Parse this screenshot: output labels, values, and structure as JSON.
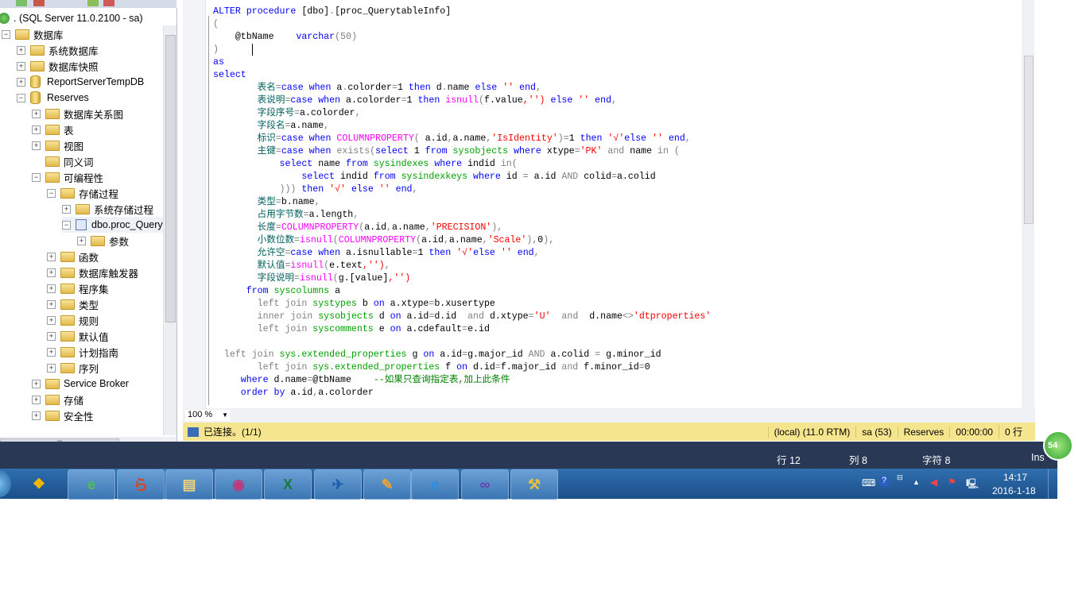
{
  "explorer": {
    "items": [
      {
        "label": ". (SQL Server 11.0.2100 - sa)",
        "icon": "server-icon",
        "level": 0,
        "exp": ""
      },
      {
        "label": "数据库",
        "icon": "folder-icon",
        "level": 0,
        "exp": "-"
      },
      {
        "label": "系统数据库",
        "icon": "folder-icon",
        "level": 1,
        "exp": "+"
      },
      {
        "label": "数据库快照",
        "icon": "folder-icon",
        "level": 1,
        "exp": "+"
      },
      {
        "label": "ReportServerTempDB",
        "icon": "database-icon",
        "level": 1,
        "exp": "+"
      },
      {
        "label": "Reserves",
        "icon": "database-icon",
        "level": 1,
        "exp": "-"
      },
      {
        "label": "数据库关系图",
        "icon": "folder-icon",
        "level": 2,
        "exp": "+"
      },
      {
        "label": "表",
        "icon": "folder-icon",
        "level": 2,
        "exp": "+"
      },
      {
        "label": "视图",
        "icon": "folder-icon",
        "level": 2,
        "exp": "+"
      },
      {
        "label": "同义词",
        "icon": "folder-icon",
        "level": 2,
        "exp": ""
      },
      {
        "label": "可编程性",
        "icon": "folder-icon",
        "level": 2,
        "exp": "-"
      },
      {
        "label": "存储过程",
        "icon": "folder-icon",
        "level": 3,
        "exp": "-"
      },
      {
        "label": "系统存储过程",
        "icon": "folder-icon",
        "level": 4,
        "exp": "+"
      },
      {
        "label": "dbo.proc_Query",
        "icon": "stored-procedure-icon",
        "level": 4,
        "exp": "-",
        "selected": true
      },
      {
        "label": "参数",
        "icon": "folder-icon",
        "level": 5,
        "exp": "+"
      },
      {
        "label": "函数",
        "icon": "folder-icon",
        "level": 3,
        "exp": "+"
      },
      {
        "label": "数据库触发器",
        "icon": "folder-icon",
        "level": 3,
        "exp": "+"
      },
      {
        "label": "程序集",
        "icon": "folder-icon",
        "level": 3,
        "exp": "+"
      },
      {
        "label": "类型",
        "icon": "folder-icon",
        "level": 3,
        "exp": "+"
      },
      {
        "label": "规则",
        "icon": "folder-icon",
        "level": 3,
        "exp": "+"
      },
      {
        "label": "默认值",
        "icon": "folder-icon",
        "level": 3,
        "exp": "+"
      },
      {
        "label": "计划指南",
        "icon": "folder-icon",
        "level": 3,
        "exp": "+"
      },
      {
        "label": "序列",
        "icon": "folder-icon",
        "level": 3,
        "exp": "+"
      },
      {
        "label": "Service Broker",
        "icon": "folder-icon",
        "level": 2,
        "exp": "+"
      },
      {
        "label": "存储",
        "icon": "folder-icon",
        "level": 2,
        "exp": "+"
      },
      {
        "label": "安全性",
        "icon": "folder-icon",
        "level": 2,
        "exp": "+"
      }
    ]
  },
  "editor": {
    "lines": [
      [
        [
          "ALTER",
          "k"
        ],
        [
          " procedure ",
          "k"
        ],
        [
          "[dbo]",
          "n"
        ],
        [
          ".",
          "g"
        ],
        [
          "[proc_QuerytableInfo]",
          "n"
        ]
      ],
      [
        [
          "(",
          "g"
        ]
      ],
      [
        [
          "    @tbName    ",
          "n"
        ],
        [
          "varchar",
          "k"
        ],
        [
          "(50)",
          "g"
        ]
      ],
      [
        [
          ")",
          "g"
        ]
      ],
      [
        [
          "as",
          "k"
        ]
      ],
      [
        [
          "select",
          "k"
        ]
      ],
      [
        [
          "        表名",
          "z"
        ],
        [
          "=",
          "g"
        ],
        [
          "case when ",
          "k"
        ],
        [
          "a",
          "n"
        ],
        [
          ".",
          "g"
        ],
        [
          "colorder",
          "n"
        ],
        [
          "=",
          "g"
        ],
        [
          "1 ",
          "n"
        ],
        [
          "then ",
          "k"
        ],
        [
          "d",
          "n"
        ],
        [
          ".",
          "g"
        ],
        [
          "name ",
          "n"
        ],
        [
          "else ",
          "k"
        ],
        [
          "'' ",
          "s"
        ],
        [
          "end",
          "k"
        ],
        [
          ",",
          "g"
        ]
      ],
      [
        [
          "        表说明",
          "z"
        ],
        [
          "=",
          "g"
        ],
        [
          "case when ",
          "k"
        ],
        [
          "a.colorder",
          "n"
        ],
        [
          "=",
          "g"
        ],
        [
          "1 ",
          "n"
        ],
        [
          "then ",
          "k"
        ],
        [
          "isnull",
          "f"
        ],
        [
          "(",
          "g"
        ],
        [
          "f.value",
          "n"
        ],
        [
          ",'')",
          "s"
        ],
        [
          " else ",
          "k"
        ],
        [
          "'' ",
          "s"
        ],
        [
          "end",
          "k"
        ],
        [
          ",",
          "g"
        ]
      ],
      [
        [
          "        字段序号",
          "z"
        ],
        [
          "=",
          "g"
        ],
        [
          "a.colorder",
          "n"
        ],
        [
          ",",
          "g"
        ]
      ],
      [
        [
          "        字段名",
          "z"
        ],
        [
          "=",
          "g"
        ],
        [
          "a.name",
          "n"
        ],
        [
          ",",
          "g"
        ]
      ],
      [
        [
          "        标识",
          "z"
        ],
        [
          "=",
          "g"
        ],
        [
          "case when ",
          "k"
        ],
        [
          "COLUMNPROPERTY",
          "f"
        ],
        [
          "( ",
          "g"
        ],
        [
          "a.id",
          "n"
        ],
        [
          ",",
          "g"
        ],
        [
          "a.name",
          "n"
        ],
        [
          ",",
          "g"
        ],
        [
          "'IsIdentity'",
          "s"
        ],
        [
          ")=",
          "g"
        ],
        [
          "1 ",
          "n"
        ],
        [
          "then ",
          "k"
        ],
        [
          "'√'",
          "s"
        ],
        [
          "else ",
          "k"
        ],
        [
          "'' ",
          "s"
        ],
        [
          "end",
          "k"
        ],
        [
          ",",
          "g"
        ]
      ],
      [
        [
          "        主键",
          "z"
        ],
        [
          "=",
          "g"
        ],
        [
          "case when ",
          "k"
        ],
        [
          "exists",
          "g"
        ],
        [
          "(",
          "g"
        ],
        [
          "select ",
          "k"
        ],
        [
          "1 ",
          "n"
        ],
        [
          "from ",
          "k"
        ],
        [
          "sysobjects ",
          "t"
        ],
        [
          "where ",
          "k"
        ],
        [
          "xtype",
          "n"
        ],
        [
          "=",
          "g"
        ],
        [
          "'PK' ",
          "s"
        ],
        [
          "and ",
          "g"
        ],
        [
          "name ",
          "n"
        ],
        [
          "in ",
          "g"
        ],
        [
          "(",
          "g"
        ]
      ],
      [
        [
          "            select ",
          "k"
        ],
        [
          "name ",
          "n"
        ],
        [
          "from ",
          "k"
        ],
        [
          "sysindexes ",
          "t"
        ],
        [
          "where ",
          "k"
        ],
        [
          "indid ",
          "n"
        ],
        [
          "in",
          "g"
        ],
        [
          "(",
          "g"
        ]
      ],
      [
        [
          "                select ",
          "k"
        ],
        [
          "indid ",
          "n"
        ],
        [
          "from ",
          "k"
        ],
        [
          "sysindexkeys ",
          "t"
        ],
        [
          "where ",
          "k"
        ],
        [
          "id ",
          "n"
        ],
        [
          "= ",
          "g"
        ],
        [
          "a.id ",
          "n"
        ],
        [
          "AND ",
          "g"
        ],
        [
          "colid",
          "n"
        ],
        [
          "=",
          "g"
        ],
        [
          "a.colid",
          "n"
        ]
      ],
      [
        [
          "            ))) ",
          "g"
        ],
        [
          "then ",
          "k"
        ],
        [
          "'√' ",
          "s"
        ],
        [
          "else ",
          "k"
        ],
        [
          "'' ",
          "s"
        ],
        [
          "end",
          "k"
        ],
        [
          ",",
          "g"
        ]
      ],
      [
        [
          "        类型",
          "z"
        ],
        [
          "=",
          "g"
        ],
        [
          "b.name",
          "n"
        ],
        [
          ",",
          "g"
        ]
      ],
      [
        [
          "        占用字节数",
          "z"
        ],
        [
          "=",
          "g"
        ],
        [
          "a.length",
          "n"
        ],
        [
          ",",
          "g"
        ]
      ],
      [
        [
          "        长度",
          "z"
        ],
        [
          "=",
          "g"
        ],
        [
          "COLUMNPROPERTY",
          "f"
        ],
        [
          "(",
          "g"
        ],
        [
          "a.id",
          "n"
        ],
        [
          ",",
          "g"
        ],
        [
          "a.name",
          "n"
        ],
        [
          ",",
          "g"
        ],
        [
          "'PRECISION'",
          "s"
        ],
        [
          "),",
          "g"
        ]
      ],
      [
        [
          "        小数位数",
          "z"
        ],
        [
          "=",
          "g"
        ],
        [
          "isnull",
          "f"
        ],
        [
          "(",
          "g"
        ],
        [
          "COLUMNPROPERTY",
          "f"
        ],
        [
          "(",
          "g"
        ],
        [
          "a.id",
          "n"
        ],
        [
          ",",
          "g"
        ],
        [
          "a.name",
          "n"
        ],
        [
          ",",
          "g"
        ],
        [
          "'Scale'",
          "s"
        ],
        [
          "),",
          "g"
        ],
        [
          "0",
          "n"
        ],
        [
          "),",
          "g"
        ]
      ],
      [
        [
          "        允许空",
          "z"
        ],
        [
          "=",
          "g"
        ],
        [
          "case when ",
          "k"
        ],
        [
          "a.isnullable",
          "n"
        ],
        [
          "=",
          "g"
        ],
        [
          "1 ",
          "n"
        ],
        [
          "then ",
          "k"
        ],
        [
          "'√'",
          "s"
        ],
        [
          "else ",
          "k"
        ],
        [
          "'' ",
          "s"
        ],
        [
          "end",
          "k"
        ],
        [
          ",",
          "g"
        ]
      ],
      [
        [
          "        默认值",
          "z"
        ],
        [
          "=",
          "g"
        ],
        [
          "isnull",
          "f"
        ],
        [
          "(",
          "g"
        ],
        [
          "e.text",
          "n"
        ],
        [
          ",'')",
          "s"
        ],
        [
          ",",
          "g"
        ]
      ],
      [
        [
          "        字段说明",
          "z"
        ],
        [
          "=",
          "g"
        ],
        [
          "isnull",
          "f"
        ],
        [
          "(",
          "g"
        ],
        [
          "g.[value]",
          "n"
        ],
        [
          ",'')",
          "s"
        ]
      ],
      [
        [
          "      from ",
          "k"
        ],
        [
          "syscolumns ",
          "t"
        ],
        [
          "a",
          "n"
        ]
      ],
      [
        [
          "        left join ",
          "g"
        ],
        [
          "systypes ",
          "t"
        ],
        [
          "b ",
          "n"
        ],
        [
          "on ",
          "k"
        ],
        [
          "a.xtype",
          "n"
        ],
        [
          "=",
          "g"
        ],
        [
          "b.xusertype",
          "n"
        ]
      ],
      [
        [
          "        inner join ",
          "g"
        ],
        [
          "sysobjects ",
          "t"
        ],
        [
          "d ",
          "n"
        ],
        [
          "on ",
          "k"
        ],
        [
          "a.id",
          "n"
        ],
        [
          "=",
          "g"
        ],
        [
          "d.id  ",
          "n"
        ],
        [
          "and ",
          "g"
        ],
        [
          "d.xtype",
          "n"
        ],
        [
          "=",
          "g"
        ],
        [
          "'U' ",
          "s"
        ],
        [
          " and  ",
          "g"
        ],
        [
          "d.name",
          "n"
        ],
        [
          "<>",
          "g"
        ],
        [
          "'dtproperties'",
          "s"
        ]
      ],
      [
        [
          "        left join ",
          "g"
        ],
        [
          "syscomments ",
          "t"
        ],
        [
          "e ",
          "n"
        ],
        [
          "on ",
          "k"
        ],
        [
          "a.cdefault",
          "n"
        ],
        [
          "=",
          "g"
        ],
        [
          "e.id",
          "n"
        ]
      ],
      [
        [
          "",
          "n"
        ]
      ],
      [
        [
          "  left join ",
          "g"
        ],
        [
          "sys.extended_properties ",
          "t"
        ],
        [
          "g ",
          "n"
        ],
        [
          "on ",
          "k"
        ],
        [
          "a.id",
          "n"
        ],
        [
          "=",
          "g"
        ],
        [
          "g.major_id ",
          "n"
        ],
        [
          "AND ",
          "g"
        ],
        [
          "a.colid ",
          "n"
        ],
        [
          "= ",
          "g"
        ],
        [
          "g.minor_id",
          "n"
        ]
      ],
      [
        [
          "        left join ",
          "g"
        ],
        [
          "sys.extended_properties ",
          "t"
        ],
        [
          "f ",
          "n"
        ],
        [
          "on ",
          "k"
        ],
        [
          "d.id",
          "n"
        ],
        [
          "=",
          "g"
        ],
        [
          "f.major_id ",
          "n"
        ],
        [
          "and ",
          "g"
        ],
        [
          "f.minor_id",
          "n"
        ],
        [
          "=",
          "g"
        ],
        [
          "0",
          "n"
        ]
      ],
      [
        [
          "     where ",
          "k"
        ],
        [
          "d.name",
          "n"
        ],
        [
          "=",
          "g"
        ],
        [
          "@tbName    ",
          "n"
        ],
        [
          "--如果只查询指定表,加上此条件",
          "c"
        ]
      ],
      [
        [
          "     order by ",
          "k"
        ],
        [
          "a.id",
          "n"
        ],
        [
          ",",
          "g"
        ],
        [
          "a.colorder",
          "n"
        ]
      ]
    ],
    "zoom": "100 %"
  },
  "statusbar": {
    "connection": "已连接。(1/1)",
    "server": "(local) (11.0 RTM)",
    "user": "sa (53)",
    "database": "Reserves",
    "elapsed": "00:00:00",
    "rows": "0 行"
  },
  "position": {
    "line": "行 12",
    "col": "列 8",
    "char": "字符 8",
    "mode": "Ins"
  },
  "taskbar": {
    "apps": [
      {
        "name": "taskbar-app-360-icon",
        "glyph": "❖",
        "color": "#f5b800"
      },
      {
        "name": "taskbar-app-browser-icon",
        "glyph": "e",
        "color": "#4dc247"
      },
      {
        "name": "taskbar-app-foxit-icon",
        "glyph": "ら",
        "color": "#e0401a"
      },
      {
        "name": "taskbar-app-explorer-icon",
        "glyph": "▤",
        "color": "#f2d27a"
      },
      {
        "name": "taskbar-app-sql-config-icon",
        "glyph": "◉",
        "color": "#c2357a"
      },
      {
        "name": "taskbar-app-excel-icon",
        "glyph": "X",
        "color": "#1e7a3a"
      },
      {
        "name": "taskbar-app-bird-icon",
        "glyph": "✈",
        "color": "#1b5fb0"
      },
      {
        "name": "taskbar-app-paint-icon",
        "glyph": "✎",
        "color": "#e8a23a"
      },
      {
        "name": "taskbar-app-ie-icon",
        "glyph": "e",
        "color": "#2b8be0"
      },
      {
        "name": "taskbar-app-vs-icon",
        "glyph": "∞",
        "color": "#6a3fb0"
      },
      {
        "name": "taskbar-app-ssms-icon",
        "glyph": "⚒",
        "color": "#e8c040"
      }
    ],
    "time": "14:17",
    "date": "2016-1-18",
    "badge": "54"
  }
}
